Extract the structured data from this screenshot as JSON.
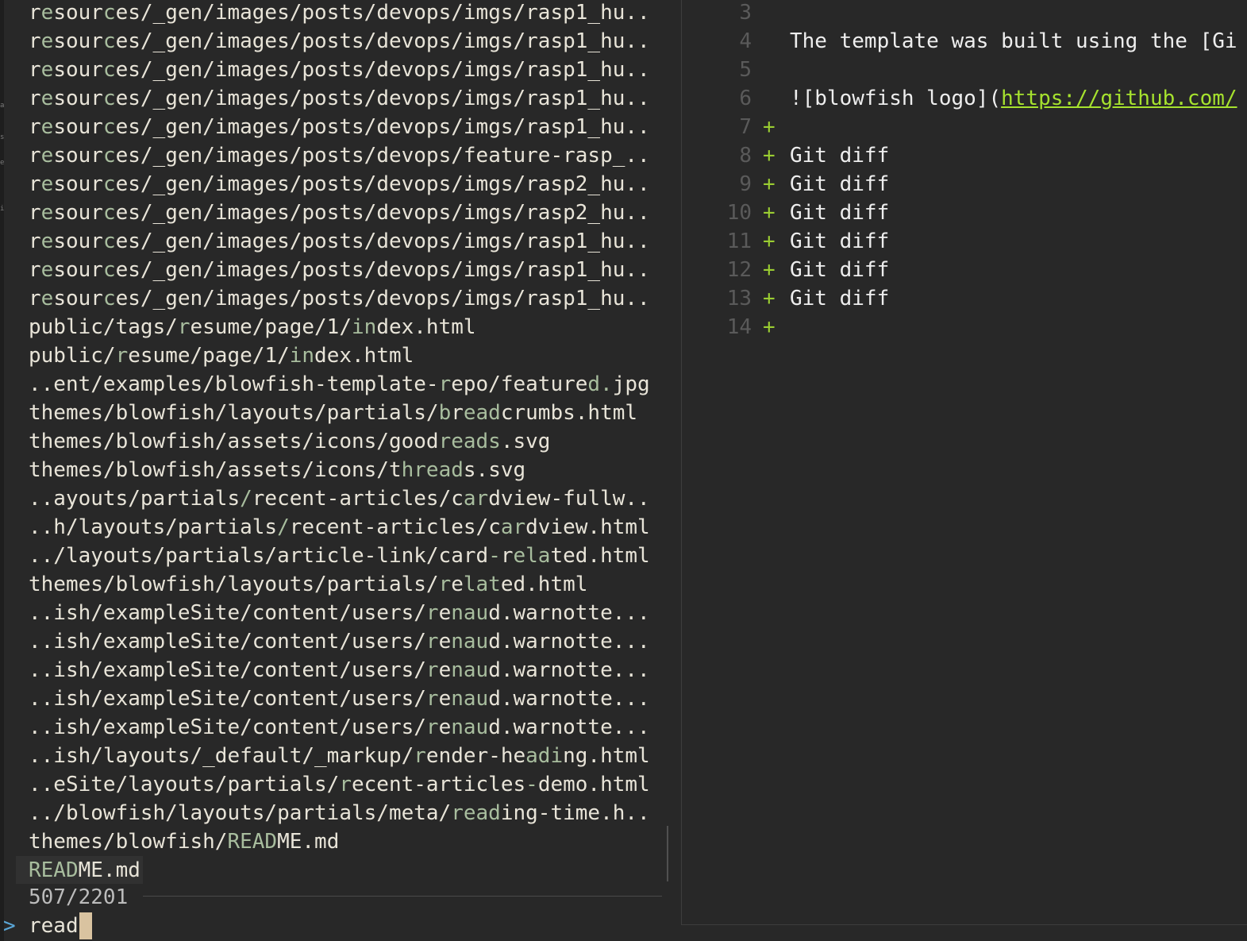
{
  "left_edge_marks": [
    "a",
    "s",
    "e",
    "i"
  ],
  "results": [
    {
      "text": "resources/_gen/images/posts/devops/imgs/rasp1_hu..",
      "match": [
        1,
        2
      ],
      "match2": [
        6,
        7
      ]
    },
    {
      "text": "resources/_gen/images/posts/devops/imgs/rasp1_hu..",
      "match": [
        1,
        2
      ],
      "match2": [
        6,
        7
      ]
    },
    {
      "text": "resources/_gen/images/posts/devops/imgs/rasp1_hu..",
      "match": [
        1,
        2
      ],
      "match2": [
        6,
        7
      ]
    },
    {
      "text": "resources/_gen/images/posts/devops/imgs/rasp1_hu..",
      "match": [
        1,
        2
      ],
      "match2": [
        6,
        7
      ]
    },
    {
      "text": "resources/_gen/images/posts/devops/imgs/rasp1_hu..",
      "match": [
        1,
        2
      ],
      "match2": [
        6,
        7
      ]
    },
    {
      "text": "resources/_gen/images/posts/devops/feature-rasp_..",
      "match": [
        1,
        2
      ],
      "match2": [
        6,
        7
      ]
    },
    {
      "text": "resources/_gen/images/posts/devops/imgs/rasp2_hu..",
      "match": [
        1,
        2
      ],
      "match2": [
        6,
        7
      ]
    },
    {
      "text": "resources/_gen/images/posts/devops/imgs/rasp2_hu..",
      "match": [
        1,
        2
      ],
      "match2": [
        6,
        7
      ]
    },
    {
      "text": "resources/_gen/images/posts/devops/imgs/rasp1_hu..",
      "match": [
        1,
        2
      ],
      "match2": [
        6,
        7
      ]
    },
    {
      "text": "resources/_gen/images/posts/devops/imgs/rasp1_hu..",
      "match": [
        1,
        2
      ],
      "match2": [
        6,
        7
      ]
    },
    {
      "text": "resources/_gen/images/posts/devops/imgs/rasp1_hu..",
      "match": [
        1,
        2
      ],
      "match2": [
        6,
        7
      ]
    },
    {
      "text": "public/tags/resume/page/1/index.html",
      "match": [
        12,
        13
      ],
      "match2": [
        26,
        28
      ]
    },
    {
      "text": "public/resume/page/1/index.html",
      "match": [
        7,
        8
      ],
      "match2": [
        21,
        23
      ]
    },
    {
      "text": "..ent/examples/blowfish-template-repo/featured.jpg",
      "match": [
        33,
        34
      ],
      "match2": [
        45,
        47
      ]
    },
    {
      "text": "themes/blowfish/layouts/partials/breadcrumbs.html",
      "match": [
        33,
        34
      ],
      "match2": [
        35,
        38
      ]
    },
    {
      "text": "themes/blowfish/assets/icons/goodreads.svg",
      "match": [
        33,
        38
      ],
      "match2": [
        0,
        0
      ]
    },
    {
      "text": "themes/blowfish/assets/icons/threads.svg",
      "match": [
        30,
        35
      ],
      "match2": [
        0,
        0
      ]
    },
    {
      "text": "..ayouts/partials/recent-articles/cardview-fullw..",
      "match": [
        17,
        18
      ],
      "match2": [
        35,
        37
      ]
    },
    {
      "text": "..h/layouts/partials/recent-articles/cardview.html",
      "match": [
        20,
        21
      ],
      "match2": [
        38,
        40
      ]
    },
    {
      "text": "../layouts/partials/article-link/card-related.html",
      "match": [
        37,
        38
      ],
      "match2": [
        39,
        42
      ]
    },
    {
      "text": "themes/blowfish/layouts/partials/related.html",
      "match": [
        33,
        34
      ],
      "match2": [
        35,
        38
      ]
    },
    {
      "text": "..ish/exampleSite/content/users/renaud.warnotte...",
      "match": [
        32,
        33
      ],
      "match2": [
        34,
        37
      ]
    },
    {
      "text": "..ish/exampleSite/content/users/renaud.warnotte...",
      "match": [
        32,
        33
      ],
      "match2": [
        34,
        37
      ]
    },
    {
      "text": "..ish/exampleSite/content/users/renaud.warnotte...",
      "match": [
        32,
        33
      ],
      "match2": [
        34,
        37
      ]
    },
    {
      "text": "..ish/exampleSite/content/users/renaud.warnotte...",
      "match": [
        32,
        33
      ],
      "match2": [
        34,
        37
      ]
    },
    {
      "text": "..ish/exampleSite/content/users/renaud.warnotte...",
      "match": [
        32,
        33
      ],
      "match2": [
        34,
        37
      ]
    },
    {
      "text": "..ish/layouts/_default/_markup/render-heading.html",
      "match": [
        31,
        32
      ],
      "match2": [
        40,
        43
      ]
    },
    {
      "text": "..eSite/layouts/partials/recent-articles-demo.html",
      "match": [
        25,
        26
      ],
      "match2": [
        40,
        41
      ]
    },
    {
      "text": "../blowfish/layouts/partials/meta/reading-time.h..",
      "match": [
        34,
        38
      ],
      "match2": [
        0,
        0
      ]
    },
    {
      "text": "themes/blowfish/README.md",
      "match": [
        16,
        20
      ],
      "match2": [
        0,
        0
      ]
    },
    {
      "text": "README.md",
      "match": [
        0,
        4
      ],
      "match2": [
        0,
        0
      ],
      "selected": true
    }
  ],
  "status": {
    "count": "507/2201"
  },
  "prompt": {
    "symbol": ">",
    "query": "read"
  },
  "preview": {
    "lines": [
      {
        "num": "3",
        "sign": "",
        "text": ""
      },
      {
        "num": "4",
        "sign": "",
        "text": "The template was built using the [Gi"
      },
      {
        "num": "5",
        "sign": "",
        "text": ""
      },
      {
        "num": "6",
        "sign": "",
        "text": "![blowfish logo](",
        "link": "https://github.com/"
      },
      {
        "num": "7",
        "sign": "+",
        "text": ""
      },
      {
        "num": "8",
        "sign": "+",
        "text": "Git diff"
      },
      {
        "num": "9",
        "sign": "+",
        "text": "Git diff"
      },
      {
        "num": "10",
        "sign": "+",
        "text": "Git diff"
      },
      {
        "num": "11",
        "sign": "+",
        "text": "Git diff"
      },
      {
        "num": "12",
        "sign": "+",
        "text": "Git diff"
      },
      {
        "num": "13",
        "sign": "+",
        "text": "Git diff"
      },
      {
        "num": "14",
        "sign": "+",
        "text": ""
      }
    ]
  },
  "colors": {
    "background": "#282828",
    "text": "#e8e4d8",
    "match": "#a8bd9e",
    "selection_marker": "#d3115e",
    "cursor": "#d9c3a0",
    "prompt": "#5aa7d8",
    "diff_add": "#9acd32",
    "link": "#a6e22e",
    "line_number": "#5a5a5a"
  }
}
